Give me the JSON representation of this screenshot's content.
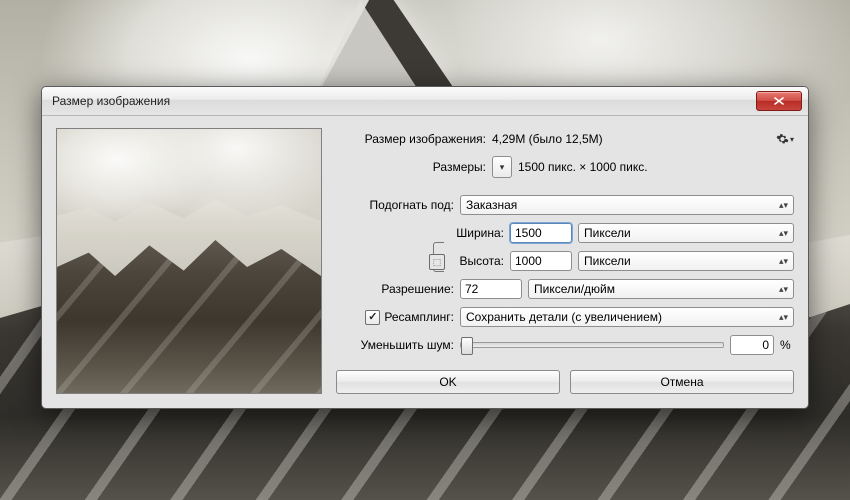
{
  "dialog": {
    "title": "Размер изображения",
    "info": {
      "size_label": "Размер изображения:",
      "size_value": "4,29M (было 12,5M)",
      "dims_label": "Размеры:",
      "dims_value": "1500 пикс.  ×  1000 пикс."
    },
    "fit": {
      "label": "Подогнать под:",
      "value": "Заказная"
    },
    "width": {
      "label": "Ширина:",
      "value": "1500",
      "unit": "Пиксели"
    },
    "height": {
      "label": "Высота:",
      "value": "1000",
      "unit": "Пиксели"
    },
    "resolution": {
      "label": "Разрешение:",
      "value": "72",
      "unit": "Пиксели/дюйм"
    },
    "resample": {
      "checkbox_label": "Ресамплинг:",
      "checked": true,
      "method": "Сохранить детали (с увеличением)"
    },
    "noise": {
      "label": "Уменьшить шум:",
      "value": "0",
      "suffix": "%"
    },
    "buttons": {
      "ok": "OK",
      "cancel": "Отмена"
    }
  }
}
